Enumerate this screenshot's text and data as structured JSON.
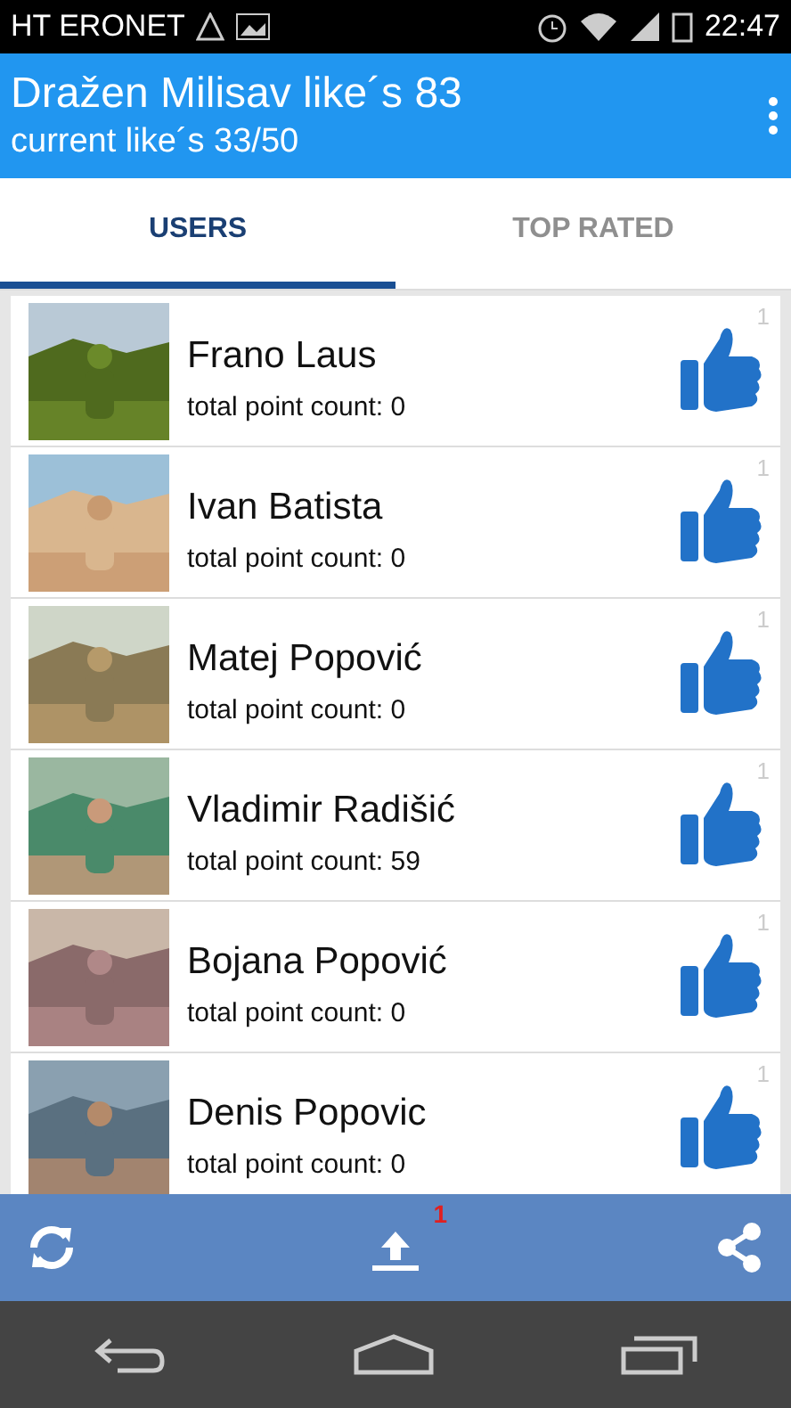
{
  "status_bar": {
    "carrier": "HT ERONET",
    "time": "22:47"
  },
  "header": {
    "title": "Dražen Milisav like´s 83",
    "subtitle": "current like´s 33/50"
  },
  "tabs": [
    {
      "label": "USERS",
      "selected": true
    },
    {
      "label": "TOP RATED",
      "selected": false
    }
  ],
  "users": [
    {
      "name": "Frano Laus",
      "points": "total point count: 0",
      "badge": "1",
      "kind": "picture"
    },
    {
      "name": "Ivan Batista",
      "points": "total point count: 0",
      "badge": "1",
      "kind": "picture"
    },
    {
      "name": "Matej Popović",
      "points": "total point count: 0",
      "badge": "1",
      "kind": "picture"
    },
    {
      "name": "Vladimir Radišić",
      "points": "total point count: 59",
      "badge": "1",
      "kind": "picture"
    },
    {
      "name": "Bojana Popović",
      "points": "total point count: 0",
      "badge": "1",
      "kind": "picture"
    },
    {
      "name": "Denis Popovic",
      "points": "total point count: 0",
      "badge": "1",
      "kind": "picture"
    }
  ],
  "bottom_bar": {
    "upload_count": "1"
  }
}
